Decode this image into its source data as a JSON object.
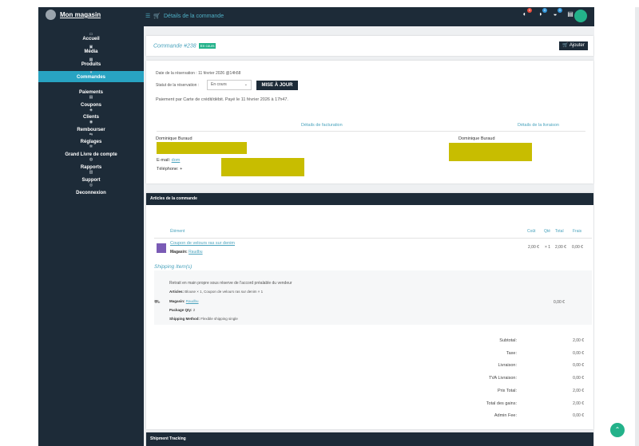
{
  "header": {
    "store_name": "Mon magasin",
    "page_title": "Détails de la commande",
    "badge_counts": [
      "0",
      "0",
      "0"
    ],
    "colors": {
      "bar": "#1d2b38",
      "accent": "#28a3c2",
      "green": "#23b28a",
      "badge_red": "#e74c3c",
      "badge_blue": "#3498db"
    }
  },
  "sidebar": {
    "items": [
      {
        "label": "Accueil",
        "icon": "monitor-icon"
      },
      {
        "label": "Média",
        "icon": "image-icon"
      },
      {
        "label": "Produits",
        "icon": "briefcase-icon"
      },
      {
        "label": "Commandes",
        "icon": "cart-icon"
      },
      {
        "label": "Paiements",
        "icon": "wallet-icon"
      },
      {
        "label": "Coupons",
        "icon": "gift-icon"
      },
      {
        "label": "Clients",
        "icon": "user-icon"
      },
      {
        "label": "Rembourser",
        "icon": "refund-icon"
      },
      {
        "label": "Réglages",
        "icon": "gear-icon"
      },
      {
        "label": "Grand Livre de compte",
        "icon": "book-icon"
      },
      {
        "label": "Rapports",
        "icon": "chart-icon"
      },
      {
        "label": "Support",
        "icon": "support-icon"
      },
      {
        "label": "Deconnexion",
        "icon": "power-icon"
      }
    ]
  },
  "order": {
    "title": "Commande #238",
    "status_badge": "En cours",
    "add_button": "Ajouter",
    "date_line": "Date de la réservation : 11 février 2026 @14h58",
    "status_label": "Statut de la réservation :",
    "status_value": "En cours",
    "update_button": "MISE À JOUR",
    "payment_line": "Paiement par Carte de crédit/débit. Payé le 11 février 2026 à 17h47."
  },
  "billing": {
    "title": "Détails de facturation",
    "name": "Dominique Buraud",
    "email_label": "E-mail:",
    "email_value": "dom",
    "phone_label": "Téléphone:",
    "phone_value": "+"
  },
  "shipping": {
    "title": "Détails de la livraison",
    "name": "Dominique Buraud"
  },
  "articles": {
    "header": "Articles de la commande",
    "columns": {
      "item": "Élément",
      "cost": "Coût",
      "qty": "Qté",
      "total": "Total",
      "taxes": "Frais"
    },
    "product": {
      "name": "Coupon de velours ras sur denim",
      "store_label": "Magasin:",
      "store_value": "Raudbu",
      "cost": "2,00 €",
      "qty": "× 1",
      "total": "2,00 €",
      "tax": "0,00 €"
    },
    "shipping_title": "Shipping Item(s)",
    "shipping_desc": "Retrait en main propre sous réserve de l'accord préalable du vendeur",
    "ship_articles_label": "Articles:",
    "ship_articles_value": "Blouse × 1, Coupon de velours ras sur denim × 1",
    "ship_store_label": "Magasin:",
    "ship_store_value": "Raudbu",
    "ship_qty_label": "Package Qty:",
    "ship_qty_value": "2",
    "ship_method_label": "Shipping Method:",
    "ship_method_value": "Flexible shipping single",
    "ship_amount": "0,00 €"
  },
  "totals": [
    {
      "label": "Subtotal:",
      "value": "2,00 €"
    },
    {
      "label": "Taxe:",
      "value": "0,00 €"
    },
    {
      "label": "Livraison:",
      "value": "0,00 €"
    },
    {
      "label": "TVA Livraison:",
      "value": "0,00 €"
    },
    {
      "label": "Prix Total:",
      "value": "2,00 €"
    },
    {
      "label": "Total des gains:",
      "value": "2,00 €"
    },
    {
      "label": "Admin Fee:",
      "value": "0,00 €"
    }
  ],
  "tracking": {
    "header": "Shipment Tracking"
  }
}
